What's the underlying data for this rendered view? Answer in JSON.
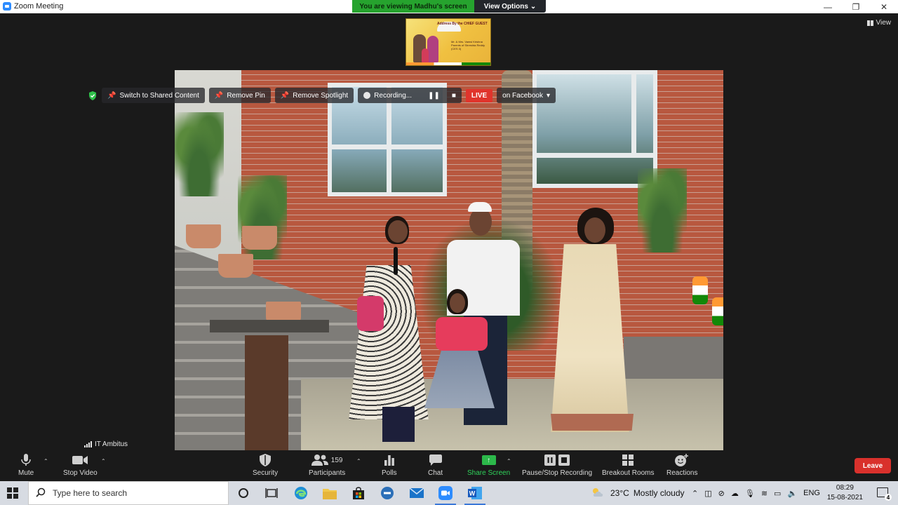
{
  "window": {
    "title": "Zoom Meeting",
    "controls": [
      "—",
      "❐",
      "✕"
    ]
  },
  "viewing_banner": {
    "text": "You are viewing Madhu's screen",
    "options_label": "View Options"
  },
  "view_button": {
    "label": "View"
  },
  "thumbnail": {
    "caption": "Address By the CHIEF GUEST",
    "subtitle": "Mr. & Mrs. Vamsi Krishna Parents of Shreshta Reddy (CES 3)"
  },
  "overlay": {
    "switch_label": "Switch to Shared Content",
    "remove_pin_label": "Remove Pin",
    "remove_spotlight_label": "Remove Spotlight",
    "recording_label": "Recording...",
    "live_label": "LIVE",
    "facebook_label": "on Facebook"
  },
  "participant_name": "IT Ambitus",
  "controls": {
    "mute": "Mute",
    "stop_video": "Stop Video",
    "security": "Security",
    "participants": "Participants",
    "participants_count": "159",
    "polls": "Polls",
    "chat": "Chat",
    "share_screen": "Share Screen",
    "pause_recording": "Pause/Stop Recording",
    "breakout_rooms": "Breakout Rooms",
    "reactions": "Reactions",
    "leave": "Leave"
  },
  "colors": {
    "leave": "#d9312c",
    "share_green": "#2cb84a",
    "live_red": "#e0342c",
    "banner_green": "#26a32e"
  },
  "taskbar": {
    "search_placeholder": "Type here to search",
    "weather_temp": "23°C",
    "weather_desc": "Mostly cloudy",
    "language": "ENG",
    "time": "08:29",
    "date": "15-08-2021",
    "notification_count": "4"
  }
}
